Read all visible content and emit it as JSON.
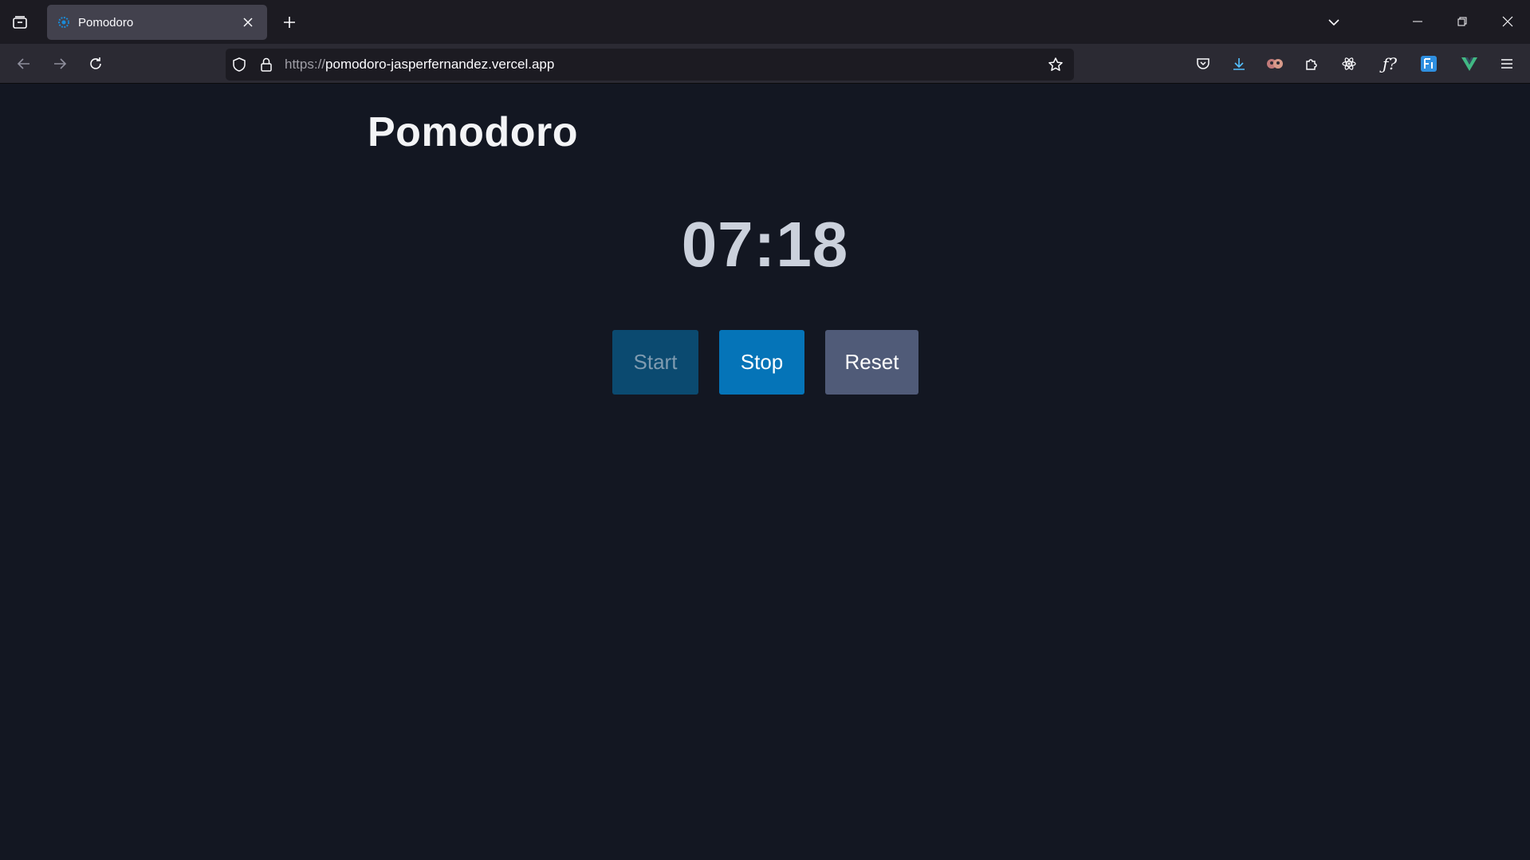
{
  "browser": {
    "tab": {
      "title": "Pomodoro",
      "favicon": "gear-favicon"
    },
    "url": {
      "scheme": "https://",
      "host": "pomodoro-jasperfernandez.vercel.app"
    },
    "toolbar_icons": [
      "pocket-icon",
      "download-icon",
      "extension-avatar-icon",
      "puzzle-icon",
      "react-devtools-icon",
      "font-finder-icon",
      "fi-extension-icon",
      "vue-devtools-icon",
      "menu-icon"
    ]
  },
  "app": {
    "title": "Pomodoro",
    "timer": "07:18",
    "buttons": {
      "start": "Start",
      "stop": "Stop",
      "reset": "Reset"
    }
  },
  "colors": {
    "background": "#131722",
    "start_button": "#0b4a70",
    "stop_button": "#0574b8",
    "reset_button": "#505b78"
  }
}
